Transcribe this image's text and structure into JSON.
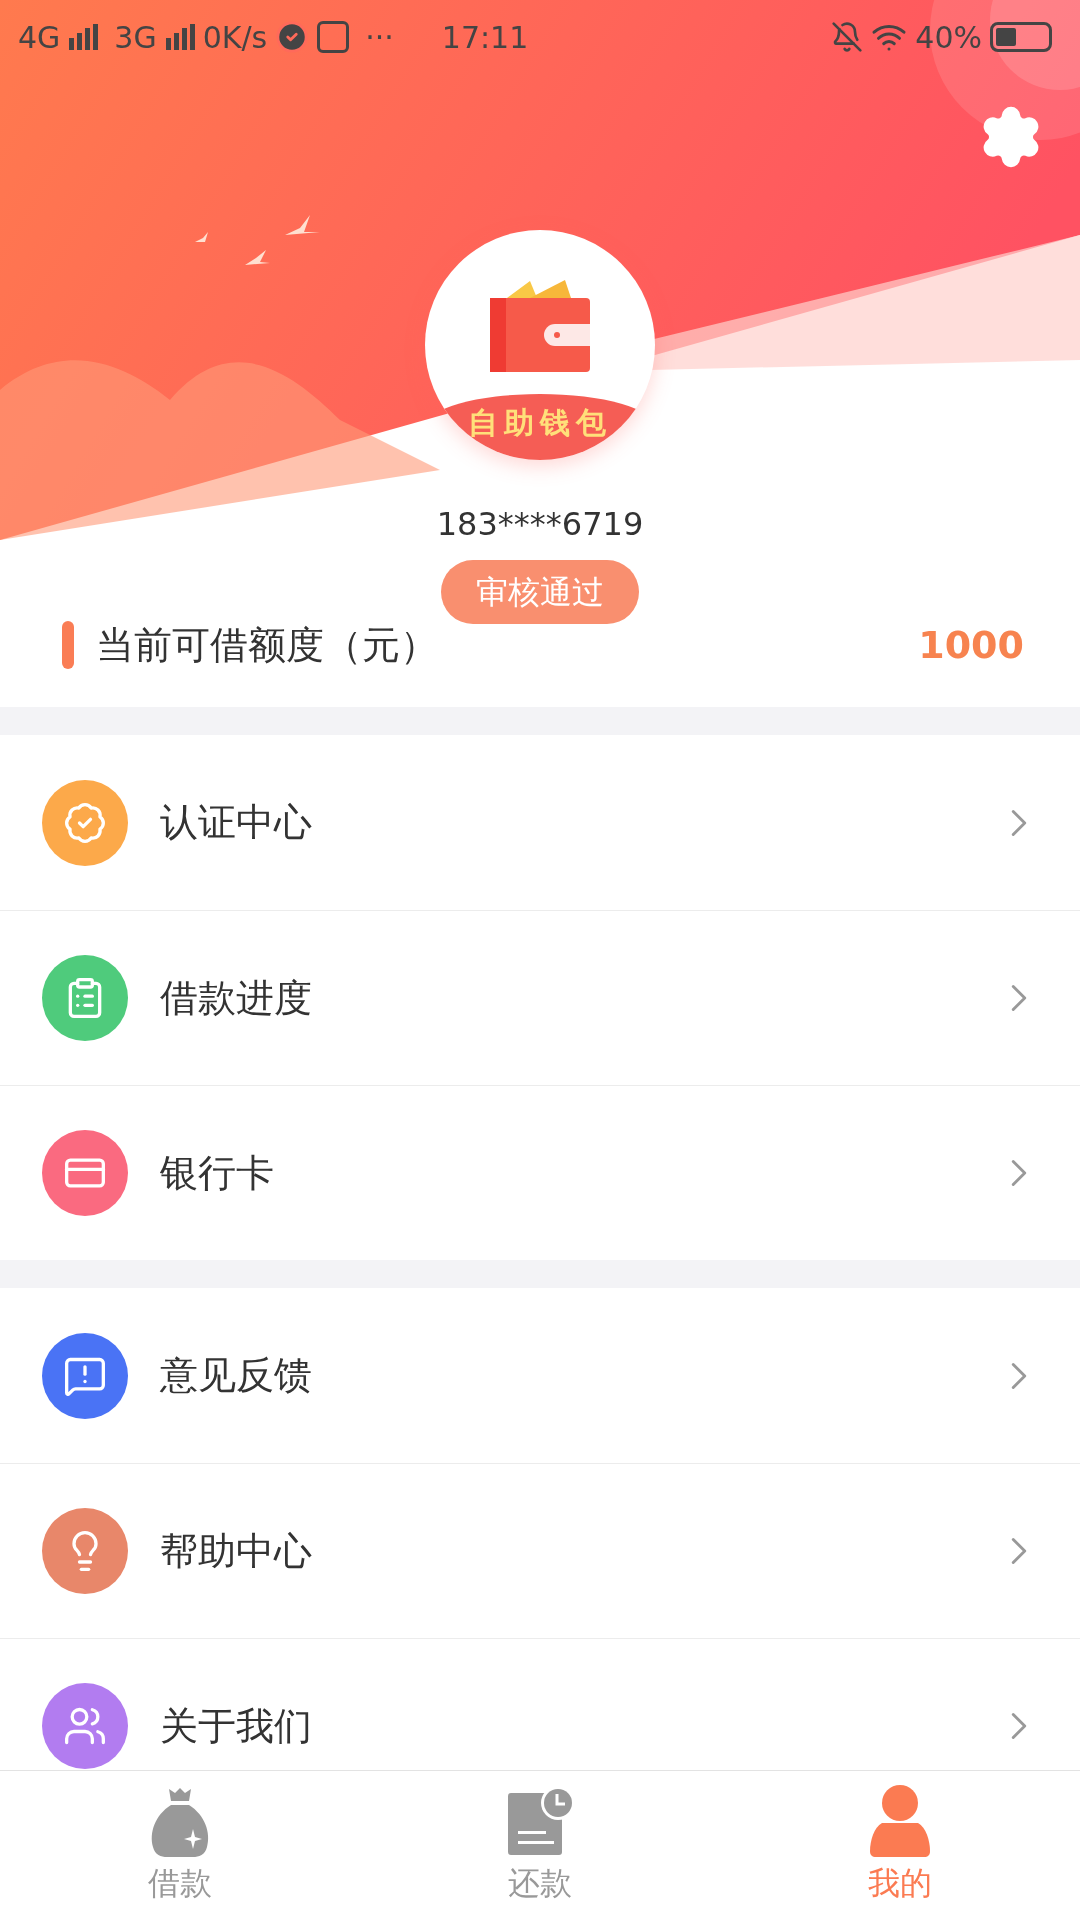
{
  "status_bar": {
    "network_1": "4G",
    "network_2": "3G",
    "speed": "0K/s",
    "more": "···",
    "time": "17:11",
    "battery": "40%"
  },
  "profile": {
    "logo_text": "自助钱包",
    "phone": "183****6719",
    "status_badge": "审核通过"
  },
  "credit": {
    "label": "当前可借额度（元）",
    "amount": "1000"
  },
  "menu_groups": [
    [
      {
        "label": "认证中心",
        "kind": "badge",
        "color": "#fca94a"
      },
      {
        "label": "借款进度",
        "kind": "clipboard",
        "color": "#4fcb7c"
      },
      {
        "label": "银行卡",
        "kind": "card",
        "color": "#fa6a80"
      }
    ],
    [
      {
        "label": "意见反馈",
        "kind": "feedback",
        "color": "#4a73f5"
      },
      {
        "label": "帮助中心",
        "kind": "help",
        "color": "#e8876a"
      },
      {
        "label": "关于我们",
        "kind": "about",
        "color": "#b27cf0"
      }
    ]
  ],
  "tab_bar": [
    {
      "label": "借款",
      "kind": "loan",
      "selected": false
    },
    {
      "label": "还款",
      "kind": "repay",
      "selected": false
    },
    {
      "label": "我的",
      "kind": "me",
      "selected": true
    }
  ]
}
